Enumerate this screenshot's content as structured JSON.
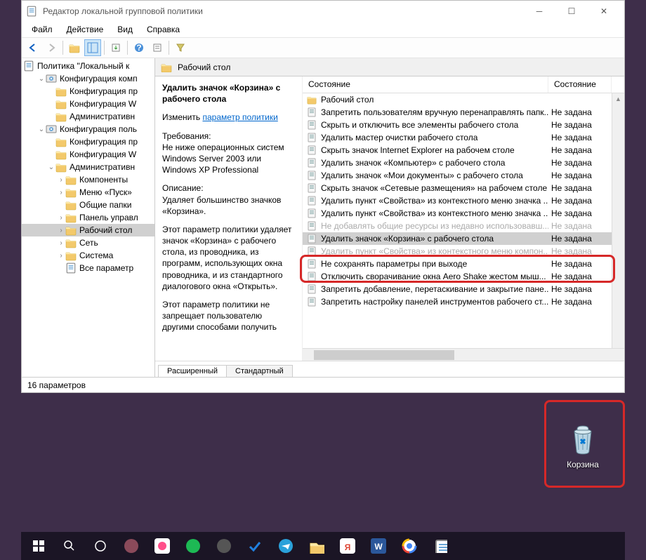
{
  "window": {
    "title": "Редактор локальной групповой политики",
    "menus": [
      "Файл",
      "Действие",
      "Вид",
      "Справка"
    ]
  },
  "tree": {
    "root": "Политика \"Локальный к",
    "items": [
      {
        "level": 1,
        "exp": "v",
        "icon": "gear",
        "text": "Конфигурация комп"
      },
      {
        "level": 2,
        "exp": "",
        "icon": "folder",
        "text": "Конфигурация пр"
      },
      {
        "level": 2,
        "exp": "",
        "icon": "folder",
        "text": "Конфигурация W"
      },
      {
        "level": 2,
        "exp": "",
        "icon": "folder",
        "text": "Административн"
      },
      {
        "level": 1,
        "exp": "v",
        "icon": "gear",
        "text": "Конфигурация поль"
      },
      {
        "level": 2,
        "exp": "",
        "icon": "folder",
        "text": "Конфигурация пр"
      },
      {
        "level": 2,
        "exp": "",
        "icon": "folder",
        "text": "Конфигурация W"
      },
      {
        "level": 2,
        "exp": "v",
        "icon": "folder",
        "text": "Административн"
      },
      {
        "level": 3,
        "exp": ">",
        "icon": "folder",
        "text": "Компоненты"
      },
      {
        "level": 3,
        "exp": ">",
        "icon": "folder",
        "text": "Меню «Пуск»"
      },
      {
        "level": 3,
        "exp": "",
        "icon": "folder",
        "text": "Общие папки"
      },
      {
        "level": 3,
        "exp": ">",
        "icon": "folder",
        "text": "Панель управл"
      },
      {
        "level": 3,
        "exp": ">",
        "icon": "folder",
        "text": "Рабочий стол",
        "selected": true
      },
      {
        "level": 3,
        "exp": ">",
        "icon": "folder",
        "text": "Сеть"
      },
      {
        "level": 3,
        "exp": ">",
        "icon": "folder",
        "text": "Система"
      },
      {
        "level": 3,
        "exp": "",
        "icon": "scroll",
        "text": "Все параметр"
      }
    ]
  },
  "content": {
    "header": "Рабочий стол",
    "policy_title": "Удалить значок «Корзина» с рабочего стола",
    "edit_prefix": "Изменить ",
    "edit_link": "параметр политики",
    "req_label": "Требования:",
    "req_text": "Не ниже операционных систем Windows Server 2003 или Windows XP Professional",
    "desc_label": "Описание:",
    "desc_text1": "Удаляет большинство значков «Корзина».",
    "desc_text2": "Этот параметр политики удаляет значок «Корзина» с рабочего стола, из проводника, из программ, использующих окна проводника, и из стандартного диалогового окна «Открыть».",
    "desc_text3": "Этот параметр политики не запрещает пользователю другими способами получить"
  },
  "list": {
    "col1": "Состояние",
    "col2": "Состояние",
    "rows": [
      {
        "icon": "folder",
        "text": "Рабочий стол",
        "state": ""
      },
      {
        "icon": "policy",
        "text": "Запретить пользователям вручную перенаправлять папк...",
        "state": "Не задана"
      },
      {
        "icon": "policy",
        "text": "Скрыть и отключить все элементы рабочего стола",
        "state": "Не задана"
      },
      {
        "icon": "policy",
        "text": "Удалить мастер очистки рабочего стола",
        "state": "Не задана"
      },
      {
        "icon": "policy",
        "text": "Скрыть значок Internet Explorer на рабочем столе",
        "state": "Не задана"
      },
      {
        "icon": "policy",
        "text": "Удалить значок «Компьютер» с рабочего стола",
        "state": "Не задана"
      },
      {
        "icon": "policy",
        "text": "Удалить значок «Мои документы» с рабочего стола",
        "state": "Не задана"
      },
      {
        "icon": "policy",
        "text": "Скрыть значок «Сетевые размещения» на рабочем столе",
        "state": "Не задана"
      },
      {
        "icon": "policy",
        "text": "Удалить пункт «Свойства» из контекстного меню значка ...",
        "state": "Не задана"
      },
      {
        "icon": "policy",
        "text": "Удалить пункт «Свойства» из контекстного меню значка ...",
        "state": "Не задана"
      },
      {
        "icon": "policy",
        "text": "Не добавлять общие ресурсы из недавно использовавш...",
        "state": "Не задана",
        "dim": true
      },
      {
        "icon": "policy",
        "text": "Удалить значок «Корзина» с рабочего стола",
        "state": "Не задана",
        "highlight": true
      },
      {
        "icon": "policy",
        "text": "Удалить пункт «Свойства» из контекстного меню компон...",
        "state": "Не задана",
        "dim": true
      },
      {
        "icon": "policy",
        "text": "Не сохранять параметры при выходе",
        "state": "Не задана"
      },
      {
        "icon": "policy",
        "text": "Отключить сворачивание окна Aero Shake жестом мыш...",
        "state": "Не задана"
      },
      {
        "icon": "policy",
        "text": "Запретить добавление, перетаскивание и закрытие пане...",
        "state": "Не задана"
      },
      {
        "icon": "policy",
        "text": "Запретить настройку панелей инструментов рабочего ст...",
        "state": "Не задана"
      }
    ]
  },
  "tabs": [
    "Расширенный",
    "Стандартный"
  ],
  "status": "16 параметров",
  "desktop": {
    "recycle": "Корзина"
  }
}
